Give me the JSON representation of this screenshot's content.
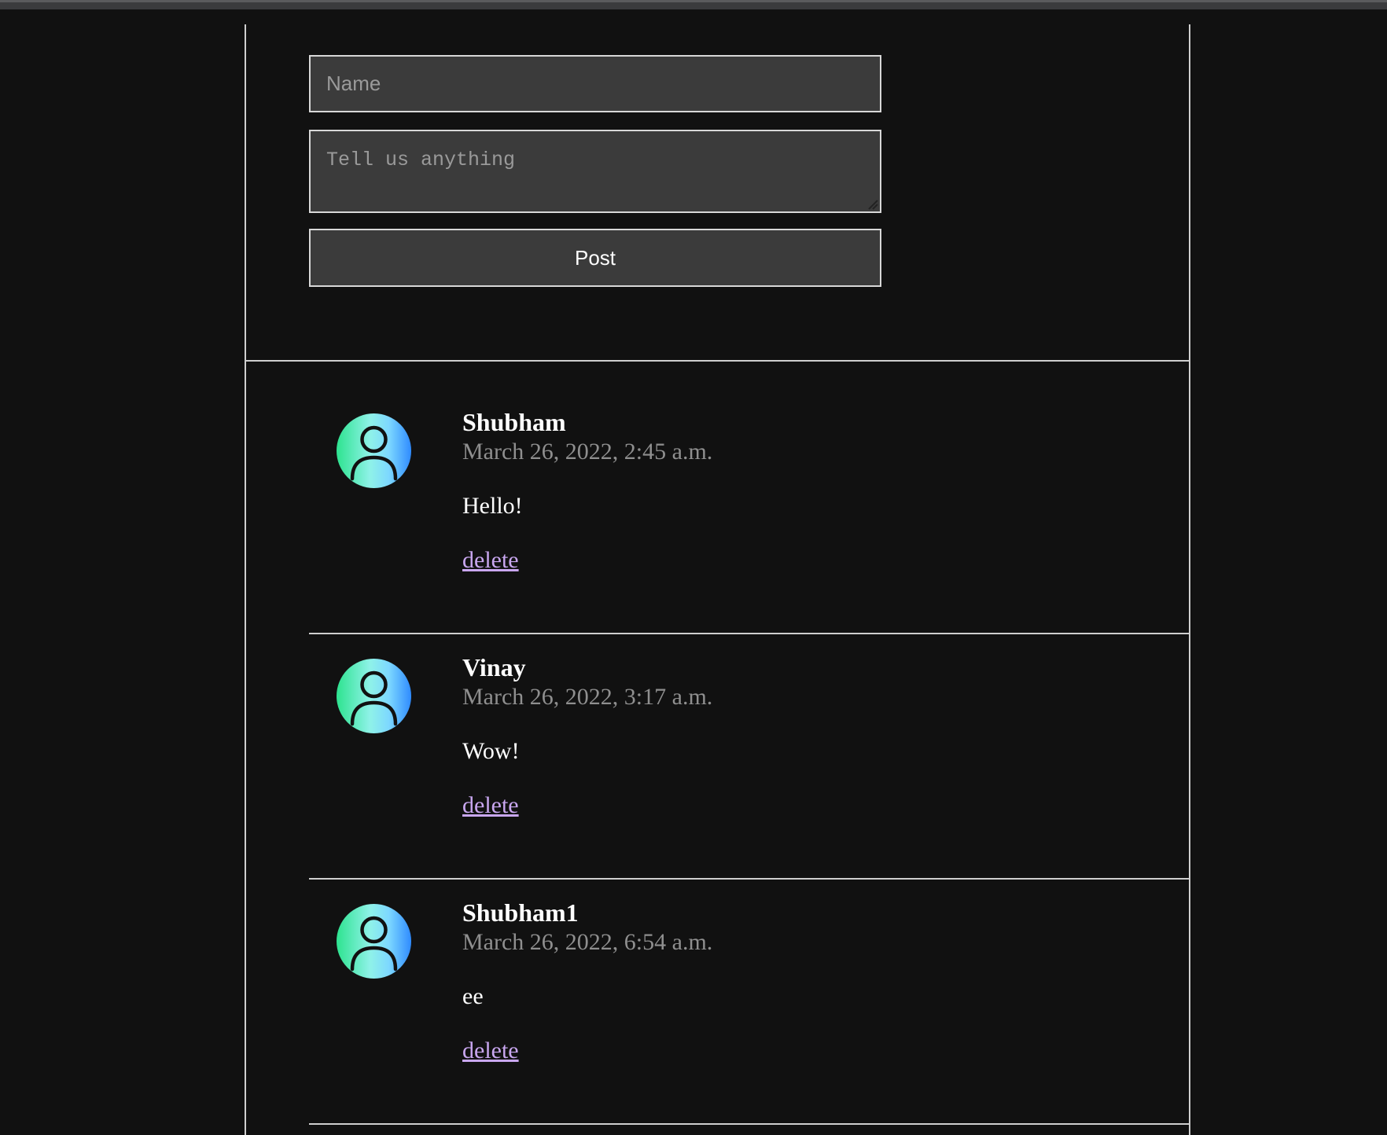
{
  "form": {
    "name_placeholder": "Name",
    "name_value": "",
    "message_placeholder": "Tell us anything",
    "message_value": "",
    "post_label": "Post"
  },
  "comments": [
    {
      "author": "Shubham",
      "timestamp": "March 26, 2022, 2:45 a.m.",
      "body": "Hello!",
      "delete_label": "delete",
      "avatar_icon": "user-icon"
    },
    {
      "author": "Vinay",
      "timestamp": "March 26, 2022, 3:17 a.m.",
      "body": "Wow!",
      "delete_label": "delete",
      "avatar_icon": "user-icon"
    },
    {
      "author": "Shubham1",
      "timestamp": "March 26, 2022, 6:54 a.m.",
      "body": "ee",
      "delete_label": "delete",
      "avatar_icon": "user-icon"
    }
  ],
  "colors": {
    "background": "#111111",
    "border": "#cfcfcf",
    "input_background": "#3b3b3b",
    "link": "#c9a7f0",
    "timestamp": "#8f8f8f"
  }
}
